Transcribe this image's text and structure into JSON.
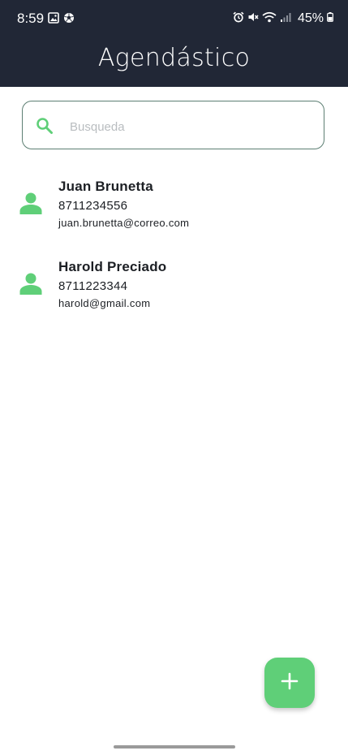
{
  "status_bar": {
    "time": "8:59",
    "battery": "45%",
    "icons_left": [
      "image-icon",
      "soccer-ball-icon"
    ],
    "icons_right": [
      "alarm-icon",
      "mute-icon",
      "wifi-icon",
      "signal-icon",
      "battery-icon"
    ]
  },
  "app_bar": {
    "title": "Agendástico"
  },
  "search": {
    "placeholder": "Busqueda",
    "value": ""
  },
  "contacts": [
    {
      "name": "Juan Brunetta",
      "phone": "8711234556",
      "email": "juan.brunetta@correo.com"
    },
    {
      "name": "Harold Preciado",
      "phone": "8711223344",
      "email": "harold@gmail.com"
    }
  ],
  "fab": {
    "icon": "plus-icon"
  },
  "colors": {
    "header_background": "#212736",
    "accent": "#5fcf78",
    "search_border": "#5d7f73",
    "text_primary": "#1c1f24",
    "placeholder": "#b9bdc0"
  }
}
